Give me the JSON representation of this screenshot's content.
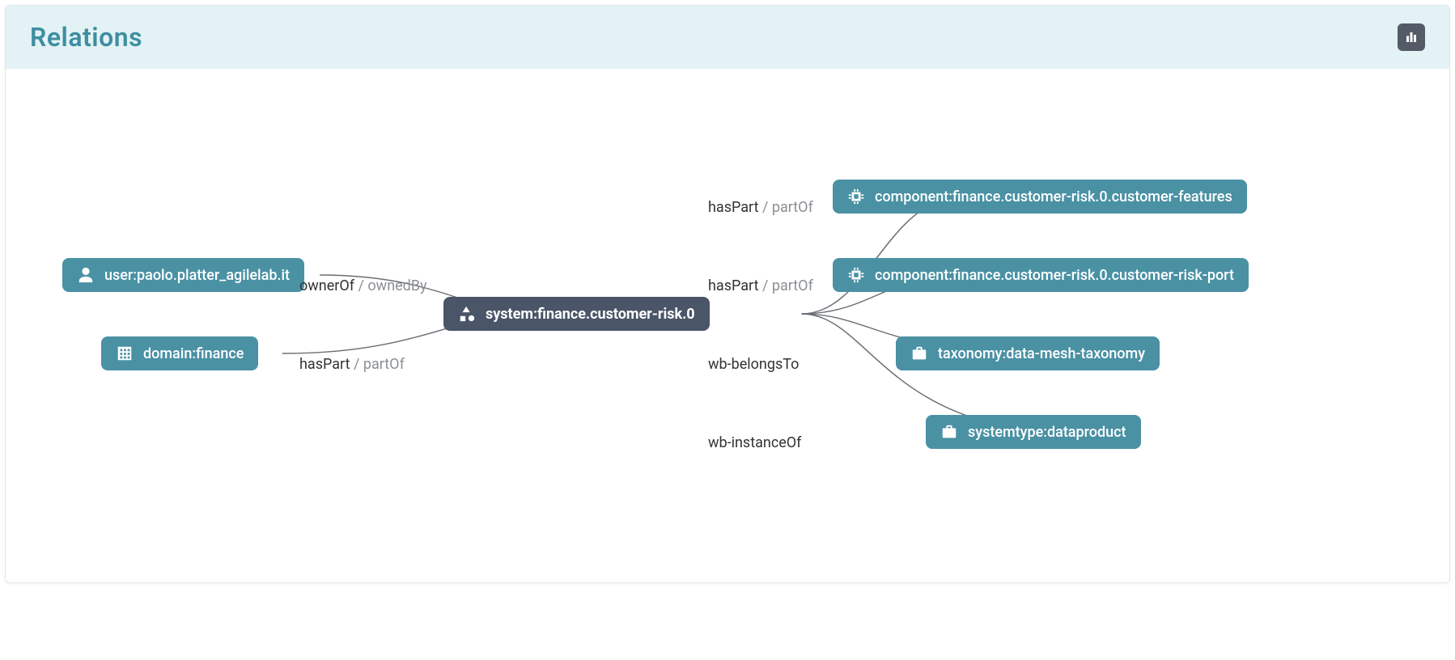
{
  "header": {
    "title": "Relations",
    "stats_button_label": "stats"
  },
  "center": {
    "label": "system:finance.customer-risk.0",
    "icon": "hierarchy"
  },
  "left_nodes": [
    {
      "icon": "person",
      "label": "user:paolo.platter_agilelab.it"
    },
    {
      "icon": "building",
      "label": "domain:finance"
    }
  ],
  "right_nodes": [
    {
      "icon": "chip",
      "label": "component:finance.customer-risk.0.customer-features"
    },
    {
      "icon": "chip",
      "label": "component:finance.customer-risk.0.customer-risk-port"
    },
    {
      "icon": "briefcase",
      "label": "taxonomy:data-mesh-taxonomy"
    },
    {
      "icon": "briefcase",
      "label": "systemtype:dataproduct"
    }
  ],
  "edges": {
    "left": [
      {
        "primary": "ownerOf",
        "inverse": "ownedBy"
      },
      {
        "primary": "hasPart",
        "inverse": "partOf"
      }
    ],
    "right": [
      {
        "primary": "hasPart",
        "inverse": "partOf"
      },
      {
        "primary": "hasPart",
        "inverse": "partOf"
      },
      {
        "primary": "wb-belongsTo",
        "inverse": ""
      },
      {
        "primary": "wb-instanceOf",
        "inverse": ""
      }
    ]
  }
}
